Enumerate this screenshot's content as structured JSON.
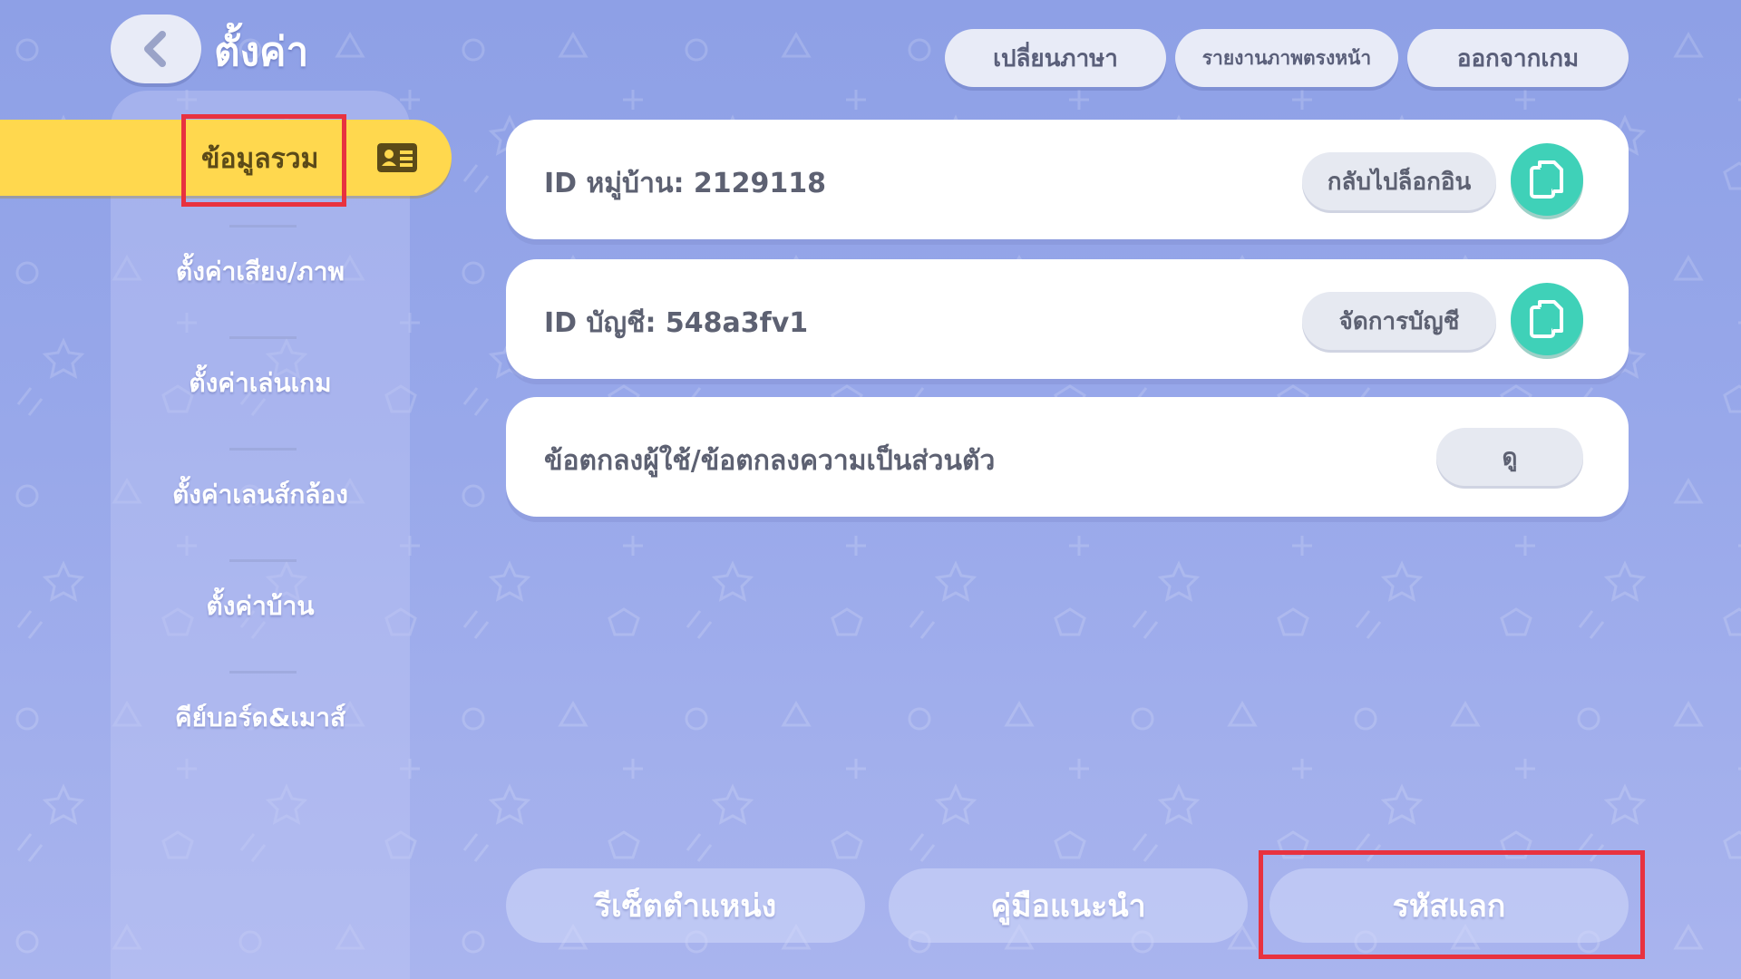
{
  "header": {
    "title": "ตั้งค่า",
    "back_icon": "chevron-left-icon",
    "buttons": {
      "change_language": "เปลี่ยนภาษา",
      "report_screen": "รายงานภาพตรงหน้า",
      "exit_game": "ออกจากเกม"
    }
  },
  "sidebar": {
    "items": [
      {
        "label": "ข้อมูลรวม",
        "icon": "id-card-icon",
        "active": true
      },
      {
        "label": "ตั้งค่าเสียง/ภาพ"
      },
      {
        "label": "ตั้งค่าเล่นเกม"
      },
      {
        "label": "ตั้งค่าเลนส์กล้อง"
      },
      {
        "label": "ตั้งค่าบ้าน"
      },
      {
        "label": "คีย์บอร์ด&เมาส์"
      }
    ]
  },
  "cards": {
    "village_id": {
      "label": "ID หมู่บ้าน: 2129118",
      "button": "กลับไปล็อกอิน",
      "icon": "copy-icon"
    },
    "account_id": {
      "label": "ID บัญชี: 548a3fv1",
      "button": "จัดการบัญชี",
      "icon": "copy-icon"
    },
    "terms": {
      "label": "ข้อตกลงผู้ใช้/ข้อตกลงความเป็นส่วนตัว",
      "button": "ดู"
    }
  },
  "bottom": {
    "reset_position": "รีเซ็ตตำแหน่ง",
    "guide": "คู่มือแนะนำ",
    "redeem_code": "รหัสแลก"
  },
  "colors": {
    "background": "#98a8ea",
    "active_tab": "#ffd84e",
    "copy_button": "#3fd1b8",
    "highlight_box": "#e8323f"
  }
}
